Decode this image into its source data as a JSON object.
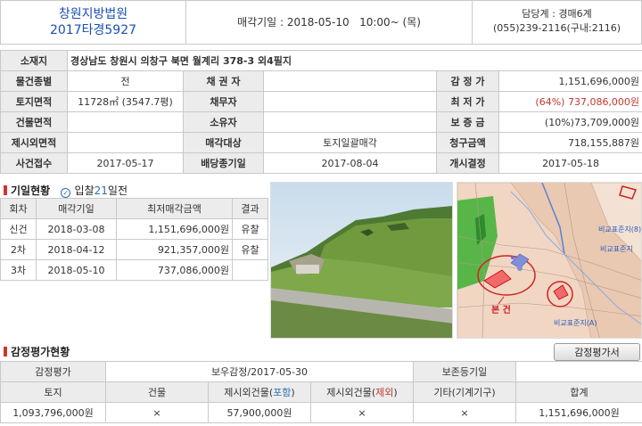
{
  "header": {
    "court": "창원지방법원",
    "case_no": "2017타경5927",
    "sale_date": "매각기일 : 2018-05-10   10:00~ (목)",
    "department": "담당계 : 경매6계",
    "phone": "(055)239-2116(구내:2116)"
  },
  "info": {
    "address_label": "소재지",
    "address": "경상남도 창원시 의창구 북면 월계리 378-3 외4필지",
    "land_type_label": "물건종별",
    "land_type": "전",
    "creditor_label": "채 권 자",
    "creditor": "",
    "appraisal_label": "감 정 가",
    "appraisal": "1,151,696,000원",
    "land_area_label": "토지면적",
    "land_area": "11728㎡ (3547.7평)",
    "debtor_label": "채무자",
    "debtor": "",
    "min_price_label": "최 저 가",
    "min_price": "(64%) 737,086,000원",
    "bldg_area_label": "건물면적",
    "bldg_area": "",
    "owner_label": "소유자",
    "owner": "",
    "deposit_label": "보 증 금",
    "deposit": "(10%)73,709,000원",
    "excluded_label": "제시외면적",
    "excluded": "",
    "sale_target_label": "매각대상",
    "sale_target": "토지일괄매각",
    "claim_label": "청구금액",
    "claim": "718,155,887원",
    "case_received_label": "사건접수",
    "case_received": "2017-05-17",
    "dividend_label": "배당종기일",
    "dividend": "2017-08-04",
    "commence_label": "개시결정",
    "commence": "2017-05-18"
  },
  "history": {
    "title": "기일현황",
    "bid_label_pre": "입찰",
    "bid_days": "21",
    "bid_label_post": "일전",
    "headers": [
      "회차",
      "매각기일",
      "최저매각금액",
      "결과"
    ],
    "rows": [
      [
        "신건",
        "2018-03-08",
        "1,151,696,000원",
        "유찰"
      ],
      [
        "2차",
        "2018-04-12",
        "921,357,000원",
        "유찰"
      ],
      [
        "3차",
        "2018-05-10",
        "737,086,000원",
        ""
      ]
    ]
  },
  "map": {
    "label_1": "비교표준지(8)",
    "label_2": "비교표준지",
    "label_3": "비교표준지(A)",
    "label_main": "본 건"
  },
  "appraisal": {
    "title": "감정평가현황",
    "doc_button": "감정평가서",
    "row1": {
      "label": "감정평가",
      "agency": "보우감정/2017-05-30",
      "base_date_label": "보존등기일",
      "base_date": ""
    },
    "headers": [
      "토지",
      "건물",
      "제시외건물(",
      "포함",
      ")",
      "제시외건물(",
      "제외",
      ")",
      "기타(기계기구)",
      "합계"
    ],
    "values": [
      "1,093,796,000원",
      "×",
      "57,900,000원",
      "×",
      "×",
      "1,151,696,000원"
    ]
  }
}
